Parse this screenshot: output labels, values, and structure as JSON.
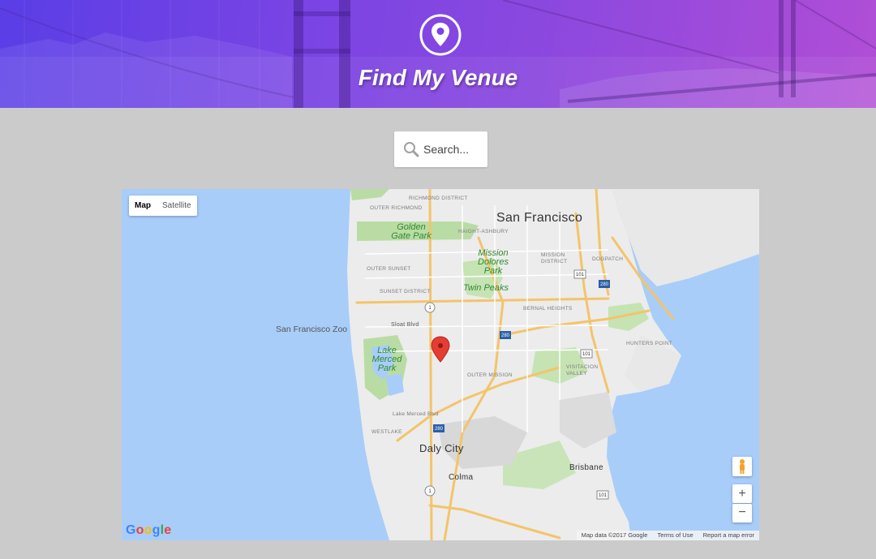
{
  "header": {
    "title": "Find My Venue",
    "logo_icon": "location-pin-icon",
    "gradient_colors": [
      "#5a3ee6",
      "#b14ed6"
    ]
  },
  "search": {
    "placeholder": "Search...",
    "icon": "search-icon"
  },
  "map": {
    "type_controls": {
      "map_label": "Map",
      "satellite_label": "Satellite",
      "selected": "Map"
    },
    "labels": {
      "city_sf": "San Francisco",
      "city_daly": "Daly City",
      "city_brisbane": "Brisbane",
      "city_colma": "Colma",
      "golden_gate_park": "Golden Gate Park",
      "mission_dolores_park": "Mission Dolores Park",
      "twin_peaks": "Twin Peaks",
      "lake_merced_park": "Lake Merced Park",
      "sf_zoo": "San Francisco Zoo",
      "inner_richmond": "RICHMOND DISTRICT",
      "outer_richmond": "OUTER RICHMOND",
      "outer_sunset": "OUTER SUNSET",
      "sunset_district": "SUNSET DISTRICT",
      "mission_district": "MISSION DISTRICT",
      "bernal_heights": "BERNAL HEIGHTS",
      "outer_mission": "OUTER MISSION",
      "visitacion_valley": "VISITACION VALLEY",
      "hunters_point": "HUNTERS POINT",
      "dogpatch": "DOGPATCH",
      "haight_ashbury": "HAIGHT-ASHBURY",
      "westlake": "WESTLAKE",
      "sloat_blvd": "Sloat Blvd",
      "lake_merced_blvd": "Lake Merced Blvd"
    },
    "zoom_in": "+",
    "zoom_out": "−",
    "logo_text": "Google",
    "attribution": {
      "map_data": "Map data ©2017 Google",
      "terms": "Terms of Use",
      "report": "Report a map error"
    },
    "marker_color": "#e63d32",
    "water_color": "#a8cdf9",
    "land_color": "#ececec",
    "park_color": "#b9dca5",
    "road_color": "#f4c46a"
  }
}
